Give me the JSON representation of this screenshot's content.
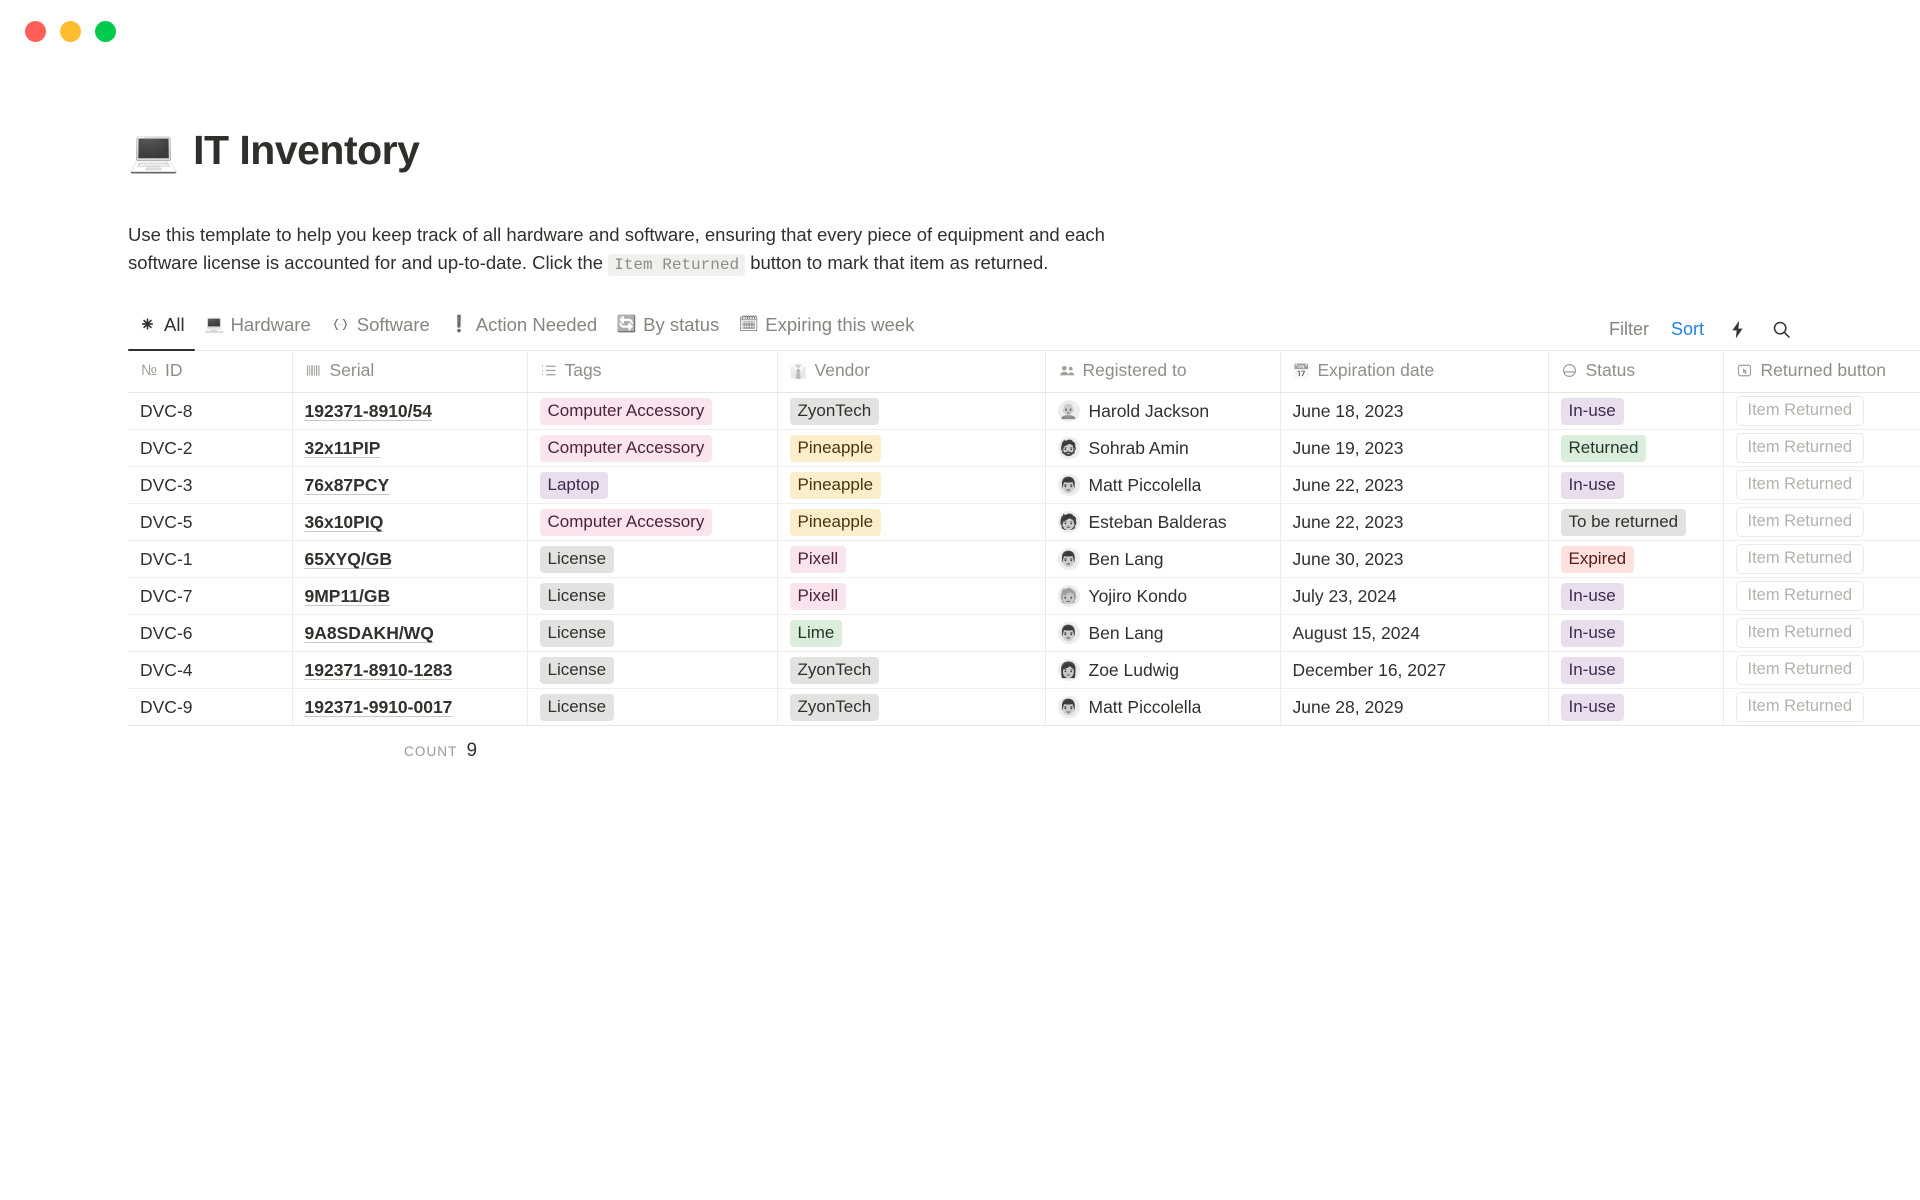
{
  "window": {
    "traffic_lights": [
      {
        "name": "close",
        "color": "#ff5f57"
      },
      {
        "name": "minimize",
        "color": "#ffbd2e"
      },
      {
        "name": "maximize",
        "color": "#00ca4e"
      }
    ]
  },
  "page": {
    "emoji": "💻",
    "title": "IT Inventory",
    "description_part1": "Use this template to help you keep track of all hardware and software, ensuring that every piece of equipment and each software license is accounted for and up-to-date. Click the ",
    "description_code": "Item Returned",
    "description_part2": " button to mark that item as returned."
  },
  "tabs": [
    {
      "label": "All",
      "icon": "asterisk-icon",
      "glyph": "✳",
      "active": true
    },
    {
      "label": "Hardware",
      "icon": "laptop-icon",
      "glyph": "💻",
      "active": false
    },
    {
      "label": "Software",
      "icon": "code-braces-icon",
      "glyph": "{·}",
      "active": false
    },
    {
      "label": "Action Needed",
      "icon": "exclamation-icon",
      "glyph": "❗",
      "active": false
    },
    {
      "label": "By status",
      "icon": "status-loop-icon",
      "glyph": "🔄",
      "active": false
    },
    {
      "label": "Expiring this week",
      "icon": "calendar-icon",
      "glyph": "🗓",
      "active": false
    }
  ],
  "tab_actions": {
    "filter_label": "Filter",
    "sort_label": "Sort",
    "sort_color": "#2383e2",
    "lightning_icon": "lightning-bolt-icon",
    "search_icon": "search-icon"
  },
  "table": {
    "columns": [
      {
        "key": "id",
        "label": "ID",
        "icon": "numero-icon",
        "glyph": "№"
      },
      {
        "key": "serial",
        "label": "Serial",
        "icon": "barcode-icon",
        "glyph": "||||"
      },
      {
        "key": "tags",
        "label": "Tags",
        "icon": "list-icon",
        "glyph": "☰"
      },
      {
        "key": "vendor",
        "label": "Vendor",
        "icon": "necktie-icon",
        "glyph": "👔"
      },
      {
        "key": "registered_to",
        "label": "Registered to",
        "icon": "people-icon",
        "glyph": "👥"
      },
      {
        "key": "expiration_date",
        "label": "Expiration date",
        "icon": "calendar-icon",
        "glyph": "📅"
      },
      {
        "key": "status",
        "label": "Status",
        "icon": "status-circle-icon",
        "glyph": "◒"
      },
      {
        "key": "returned_button",
        "label": "Returned button",
        "icon": "button-click-icon",
        "glyph": "⬚"
      }
    ],
    "rows": [
      {
        "id": "DVC-8",
        "serial": "192371-8910/54",
        "tag": {
          "label": "Computer Accessory",
          "color": "pink"
        },
        "vendor": {
          "label": "ZyonTech",
          "color": "gray"
        },
        "person": {
          "name": "Harold Jackson",
          "avatar": "👨‍🦲"
        },
        "expiration_date": "June 18, 2023",
        "status": {
          "label": "In-use",
          "color": "purple"
        },
        "button_label": "Item Returned"
      },
      {
        "id": "DVC-2",
        "serial": "32x11PIP",
        "tag": {
          "label": "Computer Accessory",
          "color": "pink"
        },
        "vendor": {
          "label": "Pineapple",
          "color": "yellow"
        },
        "person": {
          "name": "Sohrab Amin",
          "avatar": "🧔"
        },
        "expiration_date": "June 19, 2023",
        "status": {
          "label": "Returned",
          "color": "green"
        },
        "button_label": "Item Returned"
      },
      {
        "id": "DVC-3",
        "serial": "76x87PCY",
        "tag": {
          "label": "Laptop",
          "color": "purple"
        },
        "vendor": {
          "label": "Pineapple",
          "color": "yellow"
        },
        "person": {
          "name": "Matt Piccolella",
          "avatar": "👨"
        },
        "expiration_date": "June 22, 2023",
        "status": {
          "label": "In-use",
          "color": "purple"
        },
        "button_label": "Item Returned"
      },
      {
        "id": "DVC-5",
        "serial": "36x10PIQ",
        "tag": {
          "label": "Computer Accessory",
          "color": "pink"
        },
        "vendor": {
          "label": "Pineapple",
          "color": "yellow"
        },
        "person": {
          "name": "Esteban Balderas",
          "avatar": "🧑"
        },
        "expiration_date": "June 22, 2023",
        "status": {
          "label": "To be returned",
          "color": "gray"
        },
        "button_label": "Item Returned"
      },
      {
        "id": "DVC-1",
        "serial": "65XYQ/GB",
        "tag": {
          "label": "License",
          "color": "gray"
        },
        "vendor": {
          "label": "Pixell",
          "color": "pink"
        },
        "person": {
          "name": "Ben Lang",
          "avatar": "👨"
        },
        "expiration_date": "June 30, 2023",
        "status": {
          "label": "Expired",
          "color": "red"
        },
        "button_label": "Item Returned"
      },
      {
        "id": "DVC-7",
        "serial": "9MP11/GB",
        "tag": {
          "label": "License",
          "color": "gray"
        },
        "vendor": {
          "label": "Pixell",
          "color": "pink"
        },
        "person": {
          "name": "Yojiro Kondo",
          "avatar": "🧓"
        },
        "expiration_date": "July 23, 2024",
        "status": {
          "label": "In-use",
          "color": "purple"
        },
        "button_label": "Item Returned"
      },
      {
        "id": "DVC-6",
        "serial": "9A8SDAKH/WQ",
        "tag": {
          "label": "License",
          "color": "gray"
        },
        "vendor": {
          "label": "Lime",
          "color": "green"
        },
        "person": {
          "name": "Ben Lang",
          "avatar": "👨"
        },
        "expiration_date": "August 15, 2024",
        "status": {
          "label": "In-use",
          "color": "purple"
        },
        "button_label": "Item Returned"
      },
      {
        "id": "DVC-4",
        "serial": "192371-8910-1283",
        "tag": {
          "label": "License",
          "color": "gray"
        },
        "vendor": {
          "label": "ZyonTech",
          "color": "gray"
        },
        "person": {
          "name": "Zoe Ludwig",
          "avatar": "👩"
        },
        "expiration_date": "December 16, 2027",
        "status": {
          "label": "In-use",
          "color": "purple"
        },
        "button_label": "Item Returned"
      },
      {
        "id": "DVC-9",
        "serial": "192371-9910-0017",
        "tag": {
          "label": "License",
          "color": "gray"
        },
        "vendor": {
          "label": "ZyonTech",
          "color": "gray"
        },
        "person": {
          "name": "Matt Piccolella",
          "avatar": "👨"
        },
        "expiration_date": "June 28, 2029",
        "status": {
          "label": "In-use",
          "color": "purple"
        },
        "button_label": "Item Returned"
      }
    ],
    "footer": {
      "count_label": "Count",
      "count_value": "9"
    }
  }
}
